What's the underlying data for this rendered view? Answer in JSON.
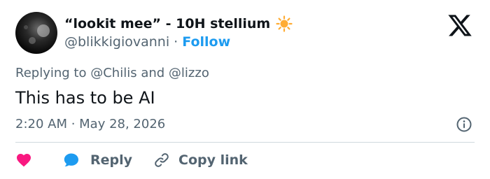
{
  "author": {
    "display_name": "“lookit mee” - 10H stellium",
    "emoji_icon": "sun-emoji-icon",
    "handle": "@blikkigiovanni",
    "separator": "·",
    "follow_label": "Follow"
  },
  "reply_context": {
    "prefix": "Replying to",
    "mention_1": "@Chilis",
    "conjunction": "and",
    "mention_2": "@lizzo"
  },
  "tweet": {
    "text": "This has to be AI",
    "timestamp": "2:20 AM · May 28, 2026"
  },
  "actions": {
    "reply_label": "Reply",
    "copy_link_label": "Copy link"
  },
  "colors": {
    "accent": "#1d9bf0",
    "like": "#f91880",
    "muted_text": "#536471",
    "primary_text": "#0f1419",
    "divider": "#cfd9de"
  }
}
